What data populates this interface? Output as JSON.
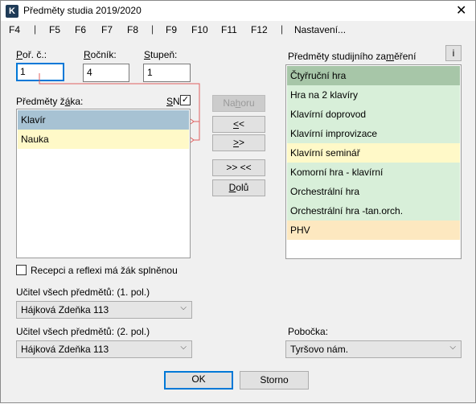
{
  "window": {
    "title": "Předměty studia 2019/2020",
    "close": "✕",
    "app_icon": "K"
  },
  "menu": {
    "items": [
      "F4",
      "F5",
      "F6",
      "F7",
      "F8",
      "F9",
      "F10",
      "F11",
      "F12",
      "Nastavení..."
    ],
    "separator": "|"
  },
  "fields": {
    "por_c": {
      "label_u": "P",
      "label_rest": "oř. č.:",
      "value": "1"
    },
    "rocnik": {
      "label_u": "R",
      "label_rest": "očník:",
      "value": "4"
    },
    "stupen": {
      "label_u": "S",
      "label_rest": "tupeň:",
      "value": "1"
    }
  },
  "student_subjects": {
    "label_pre": "Předměty ž",
    "label_u": "á",
    "label_post": "ka:",
    "sn_u": "S",
    "sn_rest": "N",
    "sn_checked": "✓",
    "items": [
      "Klavír",
      "Nauka"
    ]
  },
  "buttons": {
    "up_pre": "Na",
    "up_u": "h",
    "up_post": "oru",
    "left_u": "<",
    "left_rest": "<",
    "right_u": ">",
    "right_rest": ">",
    "swap": ">> <<",
    "down_u": "D",
    "down_rest": "olů",
    "ok": "OK",
    "cancel": "Storno",
    "info": "i"
  },
  "focus_subjects": {
    "label_pre": "Předměty studijního za",
    "label_u": "m",
    "label_post": "ěření",
    "items": [
      {
        "text": "Čtyřruční hra",
        "kind": "head"
      },
      {
        "text": "Hra na 2 klavíry",
        "kind": "green"
      },
      {
        "text": "Klavírní doprovod",
        "kind": "green"
      },
      {
        "text": "Klavírní improvizace",
        "kind": "green"
      },
      {
        "text": "Klavírní seminář",
        "kind": "yellow"
      },
      {
        "text": "Komorní hra - klavírní",
        "kind": "green"
      },
      {
        "text": "Orchestrální hra",
        "kind": "green"
      },
      {
        "text": "Orchestrální hra -tan.orch.",
        "kind": "green"
      },
      {
        "text": "PHV",
        "kind": "orange"
      }
    ]
  },
  "reception_checkbox": {
    "label": "Recepci a reflexi má žák splněnou",
    "checked": ""
  },
  "teacher1": {
    "label": "Učitel všech předmětů: (1. pol.)",
    "value": "Hájková Zdeňka 113"
  },
  "teacher2": {
    "label": "Učitel všech předmětů: (2. pol.)",
    "value": "Hájková Zdeňka 113"
  },
  "branch": {
    "label": "Pobočka:",
    "value": "Tyršovo nám."
  },
  "colors": {
    "focus": "#0078d7",
    "connector": "#e06060"
  }
}
